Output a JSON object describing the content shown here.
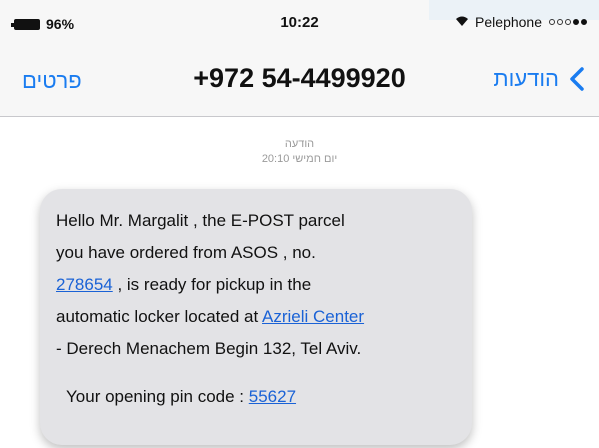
{
  "status_bar": {
    "battery": "96%",
    "time": "10:22",
    "carrier": "Pelephone"
  },
  "nav": {
    "left_label": "פרטים",
    "title": "+972 54-4499920",
    "right_label": "הודעות"
  },
  "thread": {
    "label": "הודעה",
    "timestamp": "20:10 יום חמישי"
  },
  "message": {
    "l1": "Hello Mr. Margalit , the E-POST parcel",
    "l2": "you have ordered from ASOS , no.",
    "l3_link": "278654",
    "l3_rest": " , is ready for pickup in the",
    "l4_text": "automatic locker located at ",
    "l4_link": "Azrieli Center",
    "l5": "- Derech Menachem Begin 132, Tel Aviv.",
    "pin_label": "Your opening pin code : ",
    "pin_code": "55627"
  },
  "colors": {
    "accent": "#1a7cf0",
    "link": "#1a62d6",
    "bubble": "#e3e3e6"
  },
  "icons": {
    "battery": "battery-icon",
    "wifi": "wifi-icon",
    "signal": "signal-dots-icon",
    "back": "chevron-left-icon"
  }
}
